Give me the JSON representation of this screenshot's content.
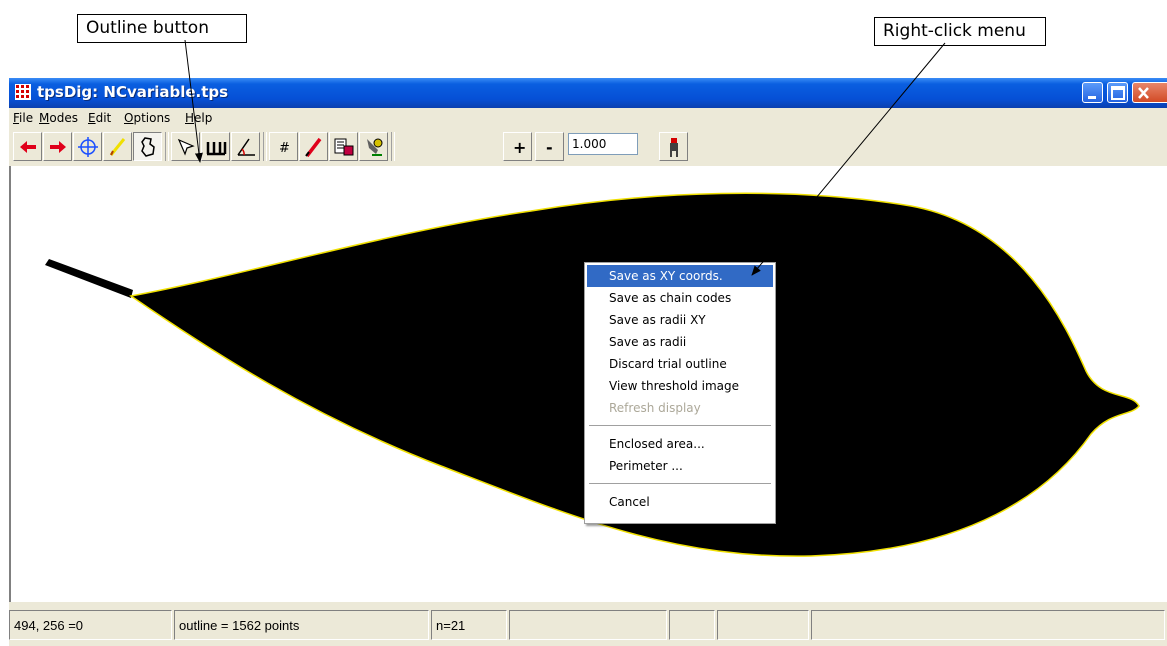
{
  "callouts": {
    "outline_button": "Outline button",
    "right_click_menu": "Right-click menu"
  },
  "window": {
    "title": "tpsDig: NCvariable.tps",
    "controls": [
      "minimize-icon",
      "maximize-icon",
      "close-icon"
    ]
  },
  "menubar": {
    "items": [
      {
        "label": "File",
        "mnemonic": "F"
      },
      {
        "label": "Modes",
        "mnemonic": "M"
      },
      {
        "label": "Edit",
        "mnemonic": "E"
      },
      {
        "label": "Options",
        "mnemonic": "O"
      },
      {
        "label": "Help",
        "mnemonic": "H"
      }
    ]
  },
  "toolbar": {
    "buttons": [
      "arrow-left-icon",
      "arrow-right-icon",
      "crosshair-icon",
      "pencil-icon",
      "outline-icon",
      "pointer-icon",
      "ruler-icon",
      "angle-icon",
      "hash-icon",
      "red-brush-icon",
      "save-icon",
      "tool-icon",
      "plus-icon",
      "minus-icon",
      "figure-icon"
    ],
    "pressed": "outline-icon",
    "plus_label": "+",
    "minus_label": "-",
    "hash_label": "#",
    "zoom_value": "1.000",
    "colors": {
      "arrow": "#e0001a",
      "crosshair": "#1a4fff",
      "outline": "#f0e000"
    }
  },
  "context_menu": {
    "items": [
      {
        "label": "Save as XY coords.",
        "state": "highlighted"
      },
      {
        "label": "Save as chain codes",
        "state": "normal"
      },
      {
        "label": "Save as radii XY",
        "state": "normal"
      },
      {
        "label": "Save as radii",
        "state": "normal"
      },
      {
        "label": "Discard trial outline",
        "state": "normal"
      },
      {
        "label": "View threshold image",
        "state": "normal"
      },
      {
        "label": "Refresh display",
        "state": "disabled"
      },
      {
        "label": "Enclosed area...",
        "state": "normal"
      },
      {
        "label": "Perimeter ...",
        "state": "normal"
      },
      {
        "label": "Cancel",
        "state": "normal"
      }
    ],
    "highlight_color": "#316ac5"
  },
  "statusbar": {
    "cells": [
      "494, 256 =0",
      "outline = 1562 points",
      "n=21",
      "",
      "",
      "",
      ""
    ]
  }
}
